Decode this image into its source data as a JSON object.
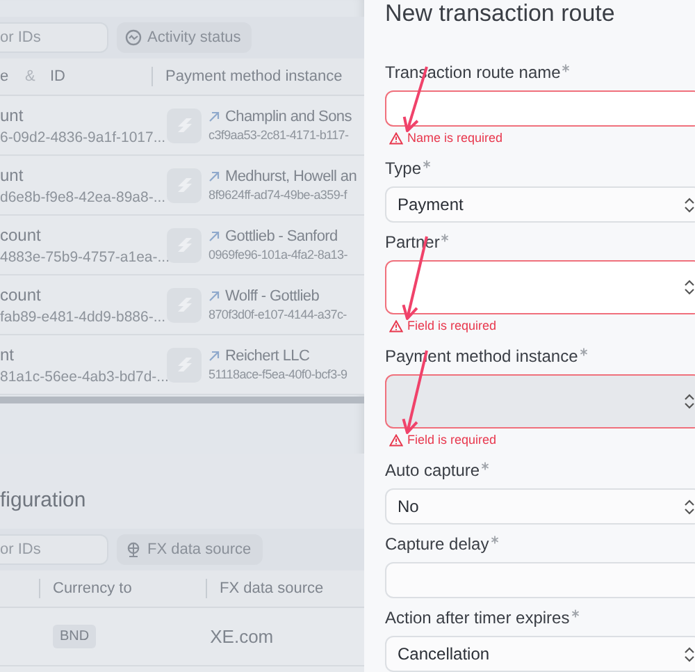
{
  "background": {
    "transactions_table": {
      "search": {
        "placeholder": "or IDs"
      },
      "filter_chip": "Activity status",
      "columns": [
        "e",
        "&",
        "ID",
        "Payment method instance"
      ],
      "rows": [
        {
          "type": "unt",
          "id": "6-09d2-4836-9a1f-1017...",
          "instance_name": "Champlin and Sons",
          "instance_id": "c3f9aa53-2c81-4171-b117-"
        },
        {
          "type": "unt",
          "id": "d6e8b-f9e8-42ea-89a8-...",
          "instance_name": "Medhurst, Howell an",
          "instance_id": "8f9624ff-ad74-49be-a359-f"
        },
        {
          "type": "count",
          "id": "4883e-75b9-4757-a1ea-...",
          "instance_name": "Gottlieb - Sanford",
          "instance_id": "0969fe96-101a-4fa2-8a13-"
        },
        {
          "type": "count",
          "id": "fab89-e481-4dd9-b886-...",
          "instance_name": "Wolff - Gottlieb",
          "instance_id": "870f3d0f-e107-4144-a37c-"
        },
        {
          "type": "nt",
          "id": "81a1c-56ee-4ab3-bd7d-...",
          "instance_name": "Reichert LLC",
          "instance_id": "51118ace-f5ea-40f0-bcf3-9"
        }
      ]
    },
    "fx_section": {
      "title": "figuration",
      "search": {
        "placeholder": "or IDs"
      },
      "filter_chip": "FX data source",
      "columns": [
        "Currency to",
        "FX data source"
      ],
      "rows": [
        {
          "currency_to": "BND",
          "fx_data_source": "XE.com"
        }
      ]
    }
  },
  "drawer": {
    "title": "New transaction route",
    "fields": [
      {
        "label": "Transaction route name",
        "required": true,
        "kind": "text",
        "error": "Name is required",
        "disabled": false,
        "annotated": true
      },
      {
        "label": "Type",
        "required": true,
        "kind": "select",
        "value": "Payment",
        "disabled": false,
        "annotated": false
      },
      {
        "label": "Partner",
        "required": true,
        "kind": "search-select",
        "error": "Field is required",
        "disabled": false,
        "annotated": true
      },
      {
        "label": "Payment method instance",
        "required": true,
        "kind": "search-select",
        "error": "Field is required",
        "disabled": true,
        "annotated": true
      },
      {
        "label": "Auto capture",
        "required": true,
        "kind": "select",
        "value": "No",
        "disabled": false,
        "annotated": false
      },
      {
        "label": "Capture delay",
        "required": true,
        "kind": "text",
        "disabled": false,
        "annotated": false
      },
      {
        "label": "Action after timer expires",
        "required": true,
        "kind": "select",
        "value": "Cancellation",
        "disabled": false,
        "annotated": false
      }
    ]
  }
}
